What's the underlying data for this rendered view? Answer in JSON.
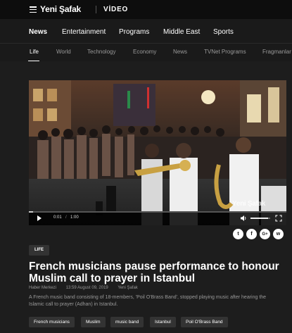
{
  "header": {
    "logo": "Yeni Şafak",
    "section": "VİDEO"
  },
  "main_nav": [
    "News",
    "Entertainment",
    "Programs",
    "Middle East",
    "Sports"
  ],
  "sub_nav": [
    "Life",
    "World",
    "Technology",
    "Economy",
    "News",
    "TVNet Programs",
    "Fragmanlar"
  ],
  "player": {
    "current_time": "0:01",
    "duration": "1:00",
    "progress": 0.017,
    "volume": 0.9,
    "watermark": "Yeni Şafak"
  },
  "share": {
    "twitter": "t",
    "facebook": "f",
    "google": "G+",
    "whatsapp": "w"
  },
  "article": {
    "category": "LIFE",
    "title": "French musicians pause performance to honour Muslim call to prayer in Istanbul",
    "author": "Haber Merkezi",
    "datetime": "13:59 August 09, 2019",
    "source": "Yeni Şafak",
    "summary": "A French music band consisting of 18-members, 'Poil O'Brass Band', stopped playing music after hearing the Islamic call to prayer (Adhan) in Istanbul."
  },
  "tags": [
    "French musicians",
    "Muslim",
    "music band",
    "Istanbul",
    "Poil O'Brass Band"
  ]
}
